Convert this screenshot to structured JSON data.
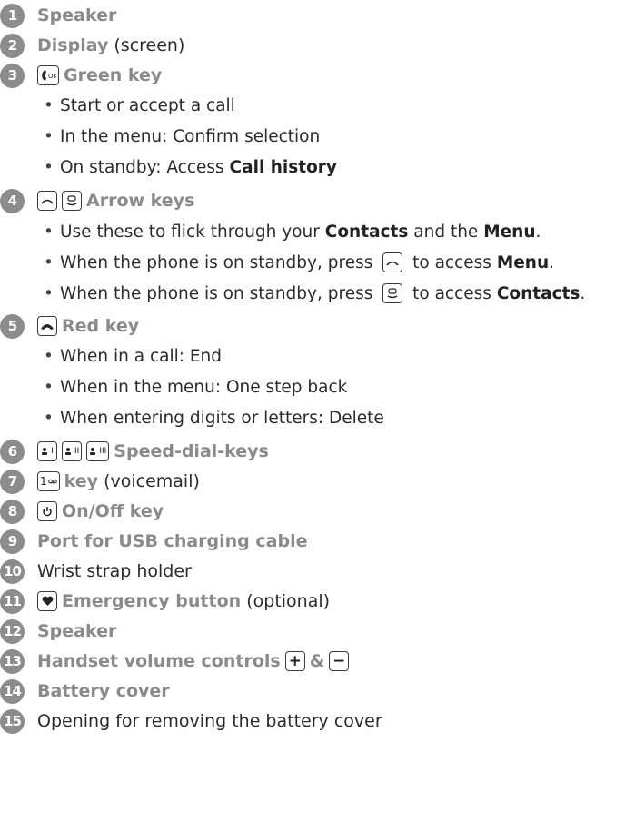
{
  "items": [
    {
      "num": "1",
      "bold": "Speaker",
      "plain": ""
    },
    {
      "num": "2",
      "bold": "Display",
      "plain": " (screen)"
    },
    {
      "num": "3",
      "bold": "Green key",
      "plain": "",
      "icon": "green-key-icon",
      "bullets": [
        {
          "pre": "Start or accept a call"
        },
        {
          "pre": "In the menu: Confirm selection"
        },
        {
          "pre": "On standby: Access ",
          "b": "Call history"
        }
      ]
    },
    {
      "num": "4",
      "bold": "Arrow keys",
      "plain": "",
      "icons": [
        "arrow-up-key-icon",
        "arrow-down-contacts-key-icon"
      ],
      "bullets": [
        {
          "pre": "Use these to flick through your ",
          "b": "Contacts",
          "mid": " and the ",
          "b2": "Menu",
          "post": "."
        },
        {
          "pre": "When the phone is on standby, press ",
          "mid2": " to access ",
          "b": "Menu",
          "post": "."
        },
        {
          "pre": "When the phone is on standby, press ",
          "mid2": " to access ",
          "b": "Contacts",
          "post": "."
        }
      ]
    },
    {
      "num": "5",
      "bold": "Red key",
      "plain": "",
      "icon": "red-key-icon",
      "bullets": [
        {
          "pre": "When in a call: End"
        },
        {
          "pre": "When in the menu: One step back"
        },
        {
          "pre": "When entering digits or letters: Delete"
        }
      ]
    },
    {
      "num": "6",
      "bold": "Speed-dial-keys",
      "plain": "",
      "key_labels": [
        "I",
        "II",
        "III"
      ]
    },
    {
      "num": "7",
      "bold": "key",
      "plain": " (voicemail)",
      "key_label": "1"
    },
    {
      "num": "8",
      "bold": "On/Off key",
      "plain": ""
    },
    {
      "num": "9",
      "bold": "Port for USB charging cable",
      "plain": ""
    },
    {
      "num": "10",
      "bold": "",
      "plain": "Wrist strap holder"
    },
    {
      "num": "11",
      "bold": "Emergency button",
      "plain": " (optional)"
    },
    {
      "num": "12",
      "bold": "Speaker",
      "plain": ""
    },
    {
      "num": "13",
      "bold": "Handset volume controls",
      "plain": "",
      "plus": "+",
      "amp": "&",
      "minus": "−"
    },
    {
      "num": "14",
      "bold": "Battery cover",
      "plain": ""
    },
    {
      "num": "15",
      "bold": "",
      "plain": "Opening for removing the battery cover"
    }
  ]
}
